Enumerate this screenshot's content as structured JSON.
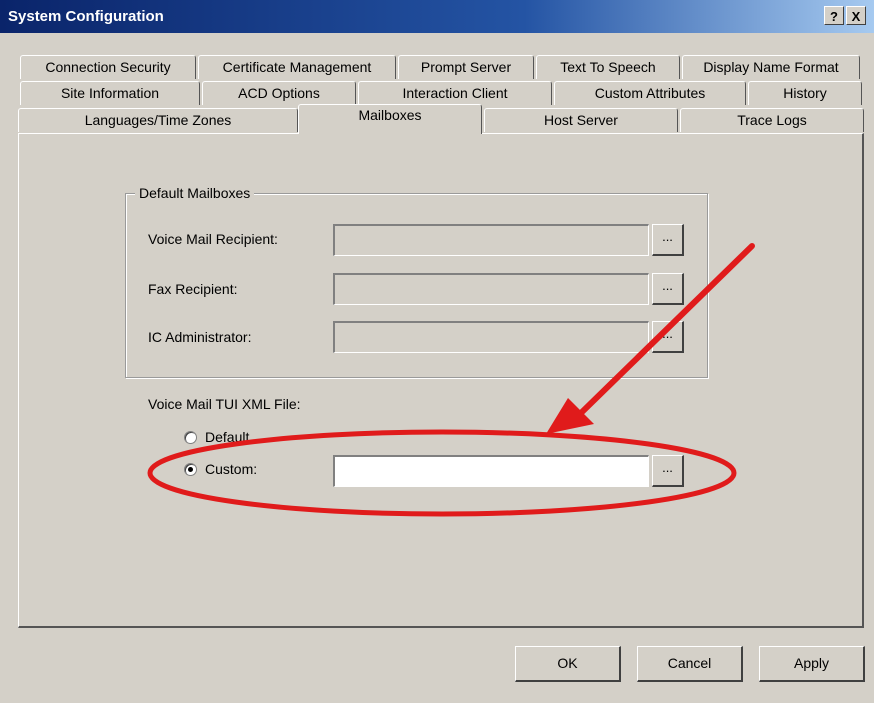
{
  "window": {
    "title": "System Configuration",
    "help_label": "?",
    "close_label": "X"
  },
  "tabs": {
    "row1": [
      "Connection Security",
      "Certificate Management",
      "Prompt Server",
      "Text To Speech",
      "Display Name Format"
    ],
    "row2": [
      "Site Information",
      "ACD Options",
      "Interaction Client",
      "Custom Attributes",
      "History"
    ],
    "row3": [
      "Languages/Time Zones",
      "Mailboxes",
      "Host Server",
      "Trace Logs"
    ],
    "active": "Mailboxes"
  },
  "default_mailboxes": {
    "group_label": "Default Mailboxes",
    "voice_mail_label": "Voice Mail Recipient:",
    "voice_mail_value": "",
    "fax_label": "Fax Recipient:",
    "fax_value": "",
    "admin_label": "IC Administrator:",
    "admin_value": "",
    "browse_label": "..."
  },
  "tui": {
    "label": "Voice Mail TUI XML File:",
    "option_default": "Default",
    "option_custom": "Custom:",
    "selected": "Custom",
    "custom_value": "",
    "browse_label": "..."
  },
  "buttons": {
    "ok": "OK",
    "cancel": "Cancel",
    "apply": "Apply"
  },
  "colors": {
    "annotation": "#e01b1b",
    "title_bar": "#0a246a",
    "face": "#d4d0c8"
  }
}
